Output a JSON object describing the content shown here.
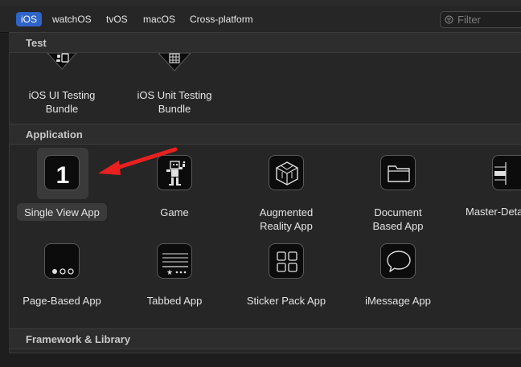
{
  "tabs": [
    {
      "label": "iOS",
      "active": true
    },
    {
      "label": "watchOS",
      "active": false
    },
    {
      "label": "tvOS",
      "active": false
    },
    {
      "label": "macOS",
      "active": false
    },
    {
      "label": "Cross-platform",
      "active": false
    }
  ],
  "filter": {
    "placeholder": "Filter"
  },
  "sections": {
    "test": "Test",
    "application": "Application",
    "framework": "Framework & Library"
  },
  "test_templates": [
    {
      "label_line1": "iOS UI Testing",
      "label_line2": "Bundle",
      "icon": "ui-test-icon"
    },
    {
      "label_line1": "iOS Unit Testing",
      "label_line2": "Bundle",
      "icon": "unit-test-icon"
    }
  ],
  "app_templates": [
    {
      "label_line1": "Single View App",
      "label_line2": "",
      "icon": "single-view-icon",
      "selected": true
    },
    {
      "label_line1": "Game",
      "label_line2": "",
      "icon": "game-icon"
    },
    {
      "label_line1": "Augmented",
      "label_line2": "Reality App",
      "icon": "ar-cube-icon"
    },
    {
      "label_line1": "Document",
      "label_line2": "Based App",
      "icon": "folder-icon"
    },
    {
      "label_line1": "Master-Detail App",
      "label_line2": "",
      "icon": "master-detail-icon"
    },
    {
      "label_line1": "Page-Based App",
      "label_line2": "",
      "icon": "page-dots-icon"
    },
    {
      "label_line1": "Tabbed App",
      "label_line2": "",
      "icon": "tab-bar-icon"
    },
    {
      "label_line1": "Sticker Pack App",
      "label_line2": "",
      "icon": "sticker-grid-icon"
    },
    {
      "label_line1": "iMessage App",
      "label_line2": "",
      "icon": "speech-bubble-icon"
    }
  ],
  "single_view_glyph": "1",
  "colors": {
    "accent": "#2f64c8",
    "annotation_arrow": "#e8201f"
  }
}
